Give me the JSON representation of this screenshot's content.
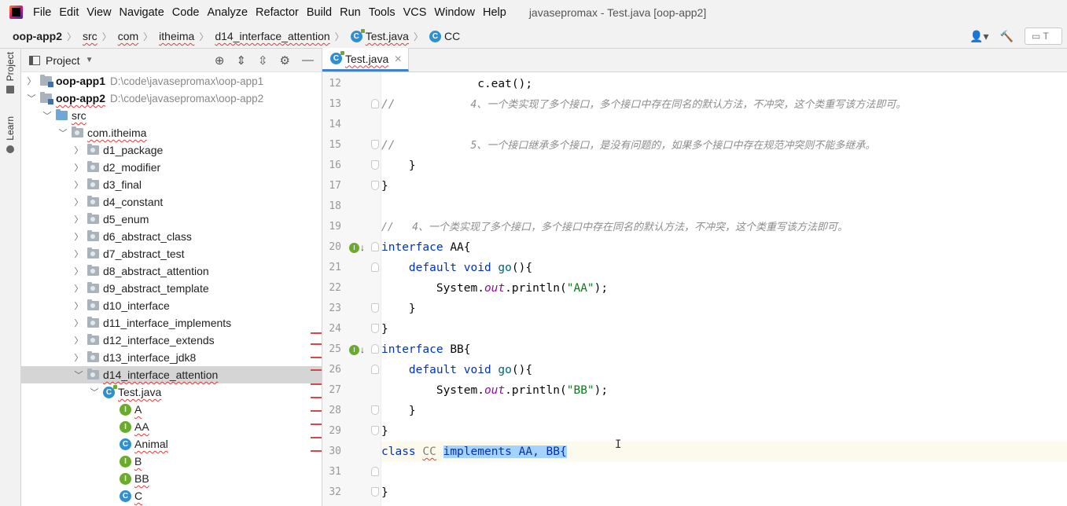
{
  "menubar": {
    "items": [
      "File",
      "Edit",
      "View",
      "Navigate",
      "Code",
      "Analyze",
      "Refactor",
      "Build",
      "Run",
      "Tools",
      "VCS",
      "Window",
      "Help"
    ],
    "window_title": "javasepromax - Test.java [oop-app2]"
  },
  "breadcrumb": [
    "oop-app2",
    "src",
    "com",
    "itheima",
    "d14_interface_attention",
    "Test.java",
    "CC"
  ],
  "left_strip": {
    "project": "Project",
    "learn": "Learn"
  },
  "project_panel": {
    "title": "Project",
    "modules": [
      {
        "name": "oop-app1",
        "path": "D:\\code\\javasepromax\\oop-app1"
      },
      {
        "name": "oop-app2",
        "path": "D:\\code\\javasepromax\\oop-app2"
      }
    ],
    "src": "src",
    "package": "com.itheima",
    "folders": [
      "d1_package",
      "d2_modifier",
      "d3_final",
      "d4_constant",
      "d5_enum",
      "d6_abstract_class",
      "d7_abstract_test",
      "d8_abstract_attention",
      "d9_abstract_template",
      "d10_interface",
      "d11_interface_implements",
      "d12_interface_extends",
      "d13_interface_jdk8",
      "d14_interface_attention"
    ],
    "file": "Test.java",
    "classes": [
      {
        "icon": "I",
        "name": "A"
      },
      {
        "icon": "I",
        "name": "AA"
      },
      {
        "icon": "C",
        "name": "Animal"
      },
      {
        "icon": "I",
        "name": "B"
      },
      {
        "icon": "I",
        "name": "BB"
      },
      {
        "icon": "C",
        "name": "C"
      }
    ]
  },
  "editor": {
    "tab": "Test.java",
    "line_numbers": [
      "12",
      "13",
      "14",
      "15",
      "16",
      "17",
      "18",
      "19",
      "20",
      "21",
      "22",
      "23",
      "24",
      "25",
      "26",
      "27",
      "28",
      "29",
      "30",
      "31",
      "32"
    ],
    "code": {
      "l12": "c.eat();",
      "l13_prefix": "//",
      "l13_comment": "4、一个类实现了多个接口，多个接口中存在同名的默认方法，不冲突，这个类重写该方法即可。",
      "l15_prefix": "//",
      "l15_comment": "5、一个接口继承多个接口，是没有问题的，如果多个接口中存在规范冲突则不能多继承。",
      "close": "}",
      "l19_comment": "//   4、一个类实现了多个接口，多个接口中存在同名的默认方法，不冲突，这个类重写该方法即可。",
      "kw_interface": "interface",
      "aa": "AA{",
      "bb": "BB{",
      "kw_default": "default",
      "kw_void": "void",
      "go": "go",
      "paren": "(){",
      "system": "System.",
      "out": "out",
      "println": ".println(",
      "str_aa": "\"AA\"",
      "str_bb": "\"BB\"",
      "end_call": ");",
      "kw_class": "class",
      "cc": "CC",
      "implements_sel": "implements AA, BB{"
    }
  },
  "colors": {
    "keyword": "#0033b3",
    "string": "#067d17",
    "comment": "#8c8c8c",
    "selection": "#a6d2ff",
    "field": "#871094"
  }
}
